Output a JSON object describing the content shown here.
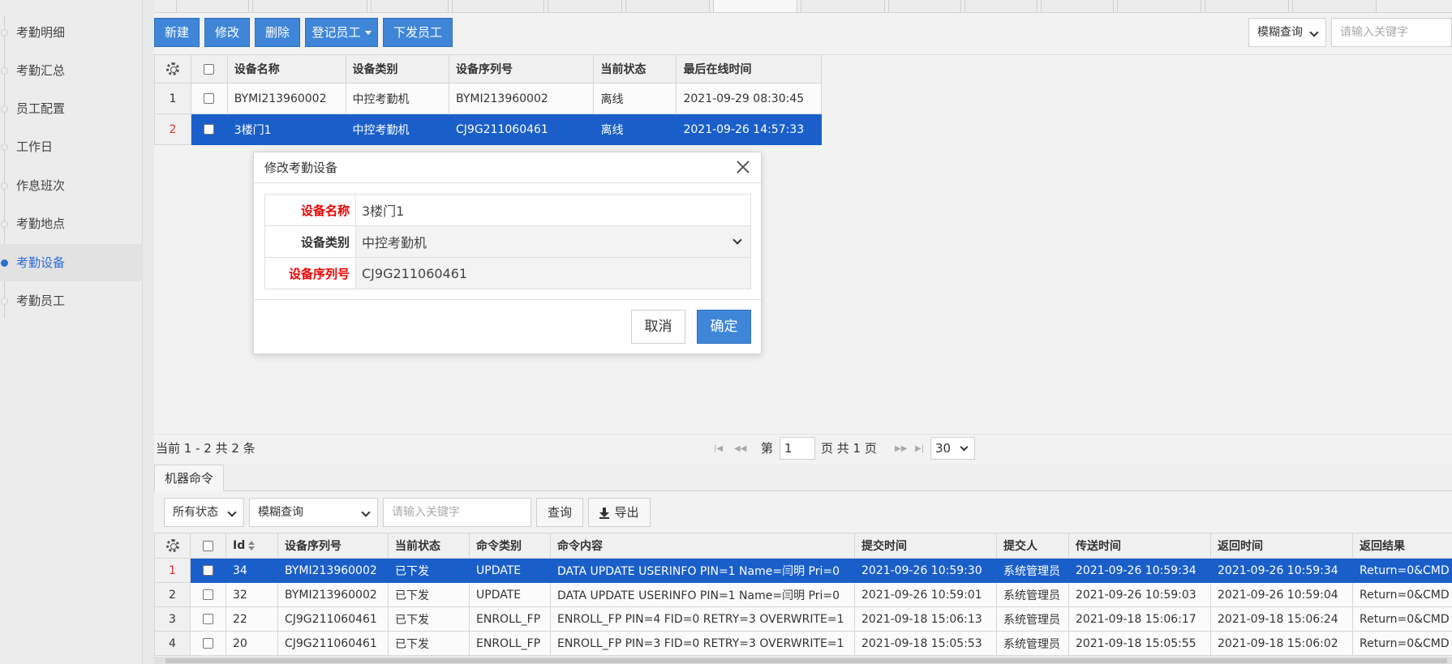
{
  "sidebar": {
    "items": [
      {
        "label": "考勤明细"
      },
      {
        "label": "考勤汇总"
      },
      {
        "label": "员工配置"
      },
      {
        "label": "工作日"
      },
      {
        "label": "作息班次"
      },
      {
        "label": "考勤地点"
      },
      {
        "label": "考勤设备"
      },
      {
        "label": "考勤员工"
      }
    ],
    "active_index": 6
  },
  "toolbar": {
    "new_label": "新建",
    "edit_label": "修改",
    "delete_label": "删除",
    "register_label": "登记员工",
    "dispatch_label": "下发员工",
    "search_mode": "模糊查询",
    "search_placeholder": "请输入关键字"
  },
  "device_grid": {
    "columns": [
      "设备名称",
      "设备类别",
      "设备序列号",
      "当前状态",
      "最后在线时间"
    ],
    "rows": [
      {
        "num": "1",
        "name": "BYMI213960002",
        "type": "中控考勤机",
        "serial": "BYMI213960002",
        "status": "离线",
        "last_online": "2021-09-29 08:30:45"
      },
      {
        "num": "2",
        "name": "3楼门1",
        "type": "中控考勤机",
        "serial": "CJ9G211060461",
        "status": "离线",
        "last_online": "2021-09-26 14:57:33"
      }
    ]
  },
  "pager": {
    "summary": "当前 1 - 2 共 2 条",
    "page_prefix": "第",
    "page_value": "1",
    "page_suffix": "页 共 1 页",
    "page_size": "30"
  },
  "modal": {
    "title": "修改考勤设备",
    "fields": [
      {
        "label": "设备名称",
        "value": "3楼门1"
      },
      {
        "label": "设备类别",
        "value": "中控考勤机"
      },
      {
        "label": "设备序列号",
        "value": "CJ9G211060461"
      }
    ],
    "cancel_label": "取消",
    "ok_label": "确定"
  },
  "commands": {
    "tab_label": "机器命令",
    "status_filter": "所有状态",
    "search_mode": "模糊查询",
    "search_placeholder": "请输入关键字",
    "query_label": "查询",
    "export_label": "导出",
    "columns": [
      "Id",
      "设备序列号",
      "当前状态",
      "命令类别",
      "命令内容",
      "提交时间",
      "提交人",
      "传送时间",
      "返回时间",
      "返回结果"
    ],
    "rows": [
      {
        "num": "1",
        "id": "34",
        "serial": "BYMI213960002",
        "status": "已下发",
        "cmd_type": "UPDATE",
        "content": "DATA UPDATE USERINFO PIN=1 Name=闫明 Pri=0",
        "submit_time": "2021-09-26 10:59:30",
        "submitter": "系统管理员",
        "send_time": "2021-09-26 10:59:34",
        "return_time": "2021-09-26 10:59:34",
        "result": "Return=0&CMD"
      },
      {
        "num": "2",
        "id": "32",
        "serial": "BYMI213960002",
        "status": "已下发",
        "cmd_type": "UPDATE",
        "content": "DATA UPDATE USERINFO PIN=1 Name=闫明 Pri=0",
        "submit_time": "2021-09-26 10:59:01",
        "submitter": "系统管理员",
        "send_time": "2021-09-26 10:59:03",
        "return_time": "2021-09-26 10:59:04",
        "result": "Return=0&CMD"
      },
      {
        "num": "3",
        "id": "22",
        "serial": "CJ9G211060461",
        "status": "已下发",
        "cmd_type": "ENROLL_FP",
        "content": "ENROLL_FP PIN=4 FID=0 RETRY=3 OVERWRITE=1",
        "submit_time": "2021-09-18 15:06:13",
        "submitter": "系统管理员",
        "send_time": "2021-09-18 15:06:17",
        "return_time": "2021-09-18 15:06:24",
        "result": "Return=0&CMD"
      },
      {
        "num": "4",
        "id": "20",
        "serial": "CJ9G211060461",
        "status": "已下发",
        "cmd_type": "ENROLL_FP",
        "content": "ENROLL_FP PIN=3 FID=0 RETRY=3 OVERWRITE=1",
        "submit_time": "2021-09-18 15:05:53",
        "submitter": "系统管理员",
        "send_time": "2021-09-18 15:05:55",
        "return_time": "2021-09-18 15:06:02",
        "result": "Return=0&CMD"
      }
    ]
  },
  "colors": {
    "accent": "#3f86d8",
    "selected_row": "#1a5fc9",
    "required_label": "#e00000",
    "sidebar_active_text": "#2c6ed5"
  }
}
